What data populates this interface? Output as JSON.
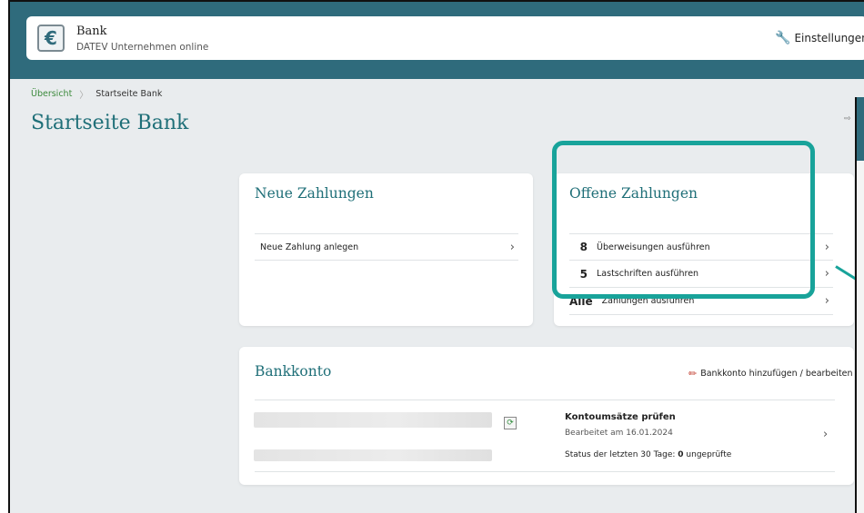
{
  "header": {
    "app_title": "Bank",
    "app_subtitle": "DATEV Unternehmen online",
    "settings_label": "Einstellungen"
  },
  "breadcrumb": {
    "root": "Übersicht",
    "current": "Startseite Bank"
  },
  "page_title": "Startseite Bank",
  "neue_zahlungen": {
    "title": "Neue Zahlungen",
    "rows": [
      {
        "label": "Neue Zahlung anlegen"
      }
    ]
  },
  "offene_zahlungen": {
    "title": "Offene Zahlungen",
    "rows": [
      {
        "count": "8",
        "label": "Überweisungen ausführen"
      },
      {
        "count": "5",
        "label": "Lastschriften ausführen"
      },
      {
        "count": "Alle",
        "label": "Zahlungen ausführen"
      }
    ]
  },
  "bankkonto": {
    "title": "Bankkonto",
    "edit_label": "Bankkonto hinzufügen / bearbeiten",
    "entry": {
      "title": "Kontoumsätze prüfen",
      "edited": "Bearbeitet am 16.01.2024",
      "status_prefix": "Status der letzten 30 Tage:",
      "status_count": "0",
      "status_suffix": "ungeprüfte"
    }
  },
  "colors": {
    "header": "#2f6b7c",
    "accent": "#1f6f78",
    "highlight": "#18a39a",
    "link_green": "#3c8a3c"
  }
}
